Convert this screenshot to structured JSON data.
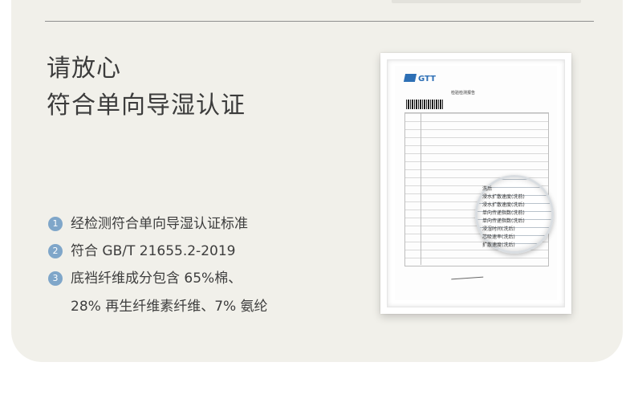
{
  "headline": {
    "line1": "请放心",
    "line2": "符合单向导湿认证"
  },
  "features": [
    {
      "num": "1",
      "text": "经检测符合单向导湿认证标准"
    },
    {
      "num": "2",
      "text": "符合 GB/T 21655.2-2019"
    },
    {
      "num": "3",
      "text": "底裆纤维成分包含 65%棉、",
      "text2": "28% 再生纤维素纤维、7% 氨纶"
    }
  ],
  "certificate": {
    "logo": "GTT",
    "title": "检验检测报告",
    "magnified_rows": [
      "洗后",
      "浸水扩散速度(洗前)",
      "浸水扩散速度(洗后)",
      "单向传递指数(洗前)",
      "单向传递指数(洗后)",
      "浸湿时间(洗后)",
      "芯吸速率(洗后)",
      "扩散速度(洗后)"
    ]
  },
  "colors": {
    "background": "#f1f0ea",
    "badge": "#7fa6c9",
    "text": "#3d3d3d",
    "logo": "#2d6fb5"
  }
}
